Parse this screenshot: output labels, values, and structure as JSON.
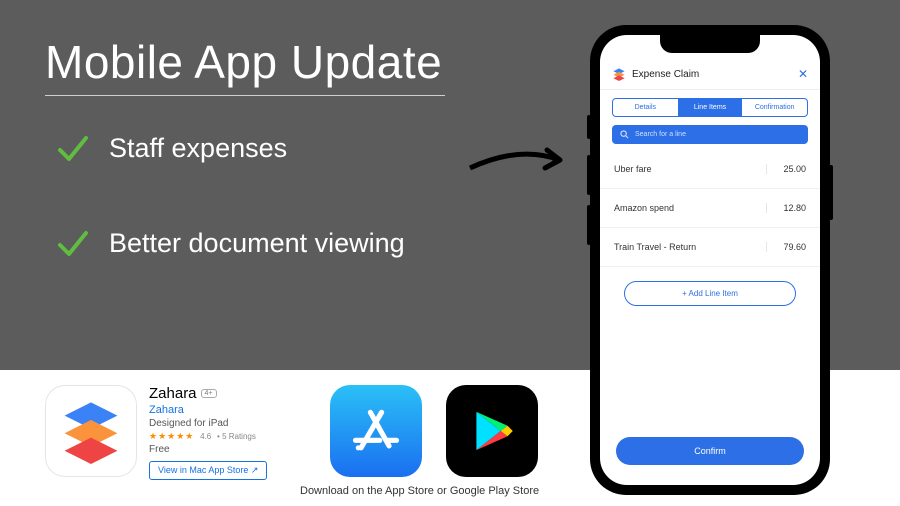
{
  "hero": {
    "title": "Mobile App Update",
    "features": [
      "Staff expenses",
      "Better document viewing"
    ]
  },
  "phone": {
    "header_title": "Expense Claim",
    "tabs": [
      "Details",
      "Line Items",
      "Confirmation"
    ],
    "active_tab_index": 1,
    "search_placeholder": "Search for a line",
    "line_items": [
      {
        "label": "Uber fare",
        "amount": "25.00"
      },
      {
        "label": "Amazon spend",
        "amount": "12.80"
      },
      {
        "label": "Train Travel - Return",
        "amount": "79.60"
      }
    ],
    "add_button": "+ Add Line Item",
    "confirm_button": "Confirm"
  },
  "app_listing": {
    "name": "Zahara",
    "age_rating": "4+",
    "vendor": "Zahara",
    "subtitle": "Designed for iPad",
    "rating": "4.6",
    "rating_count": "5 Ratings",
    "price": "Free",
    "view_button": "View in Mac App Store ↗"
  },
  "download_caption": "Download on the App Store or Google Play Store",
  "colors": {
    "hero_bg": "#5c5c5c",
    "accent_blue": "#2d6fe6",
    "check_green": "#5fbe3f"
  }
}
